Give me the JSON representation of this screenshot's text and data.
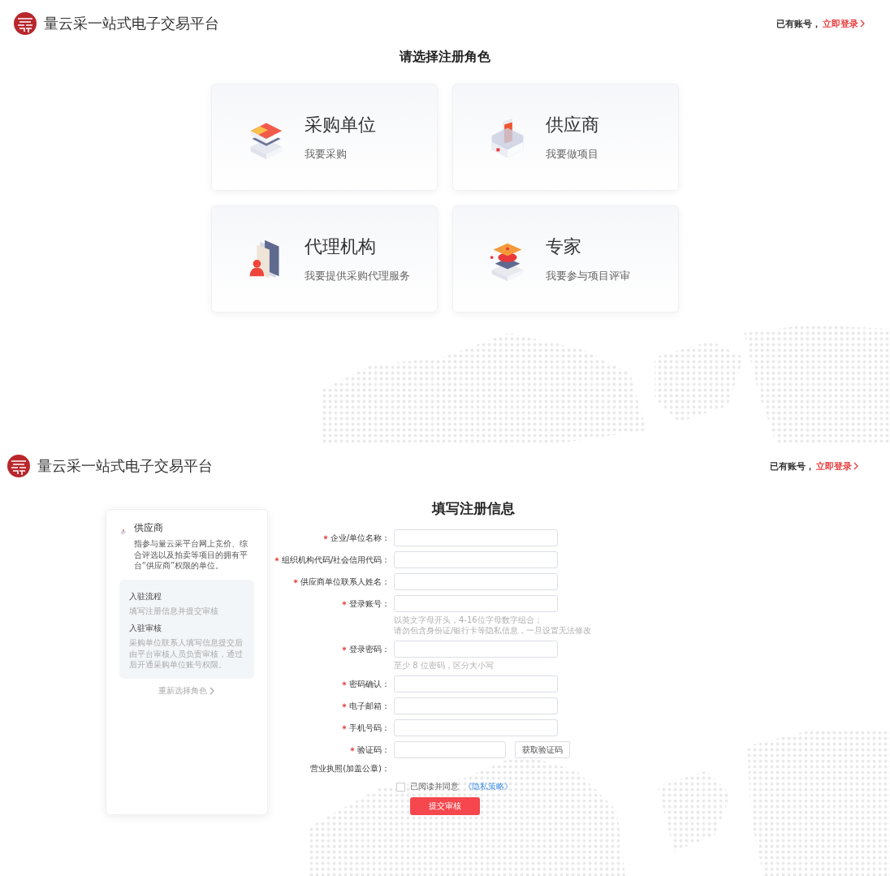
{
  "role_screen": {
    "header": {
      "site_title": "量云采一站式电子交易平台",
      "login_prompt": "已有账号，",
      "login_link": "立即登录"
    },
    "title": "请选择注册角色",
    "roles": [
      {
        "kind": "buyer",
        "name": "采购单位",
        "desc": "我要采购"
      },
      {
        "kind": "supplier",
        "name": "供应商",
        "desc": "我要做项目"
      },
      {
        "kind": "agency",
        "name": "代理机构",
        "desc": "我要提供采购代理服务"
      },
      {
        "kind": "expert",
        "name": "专家",
        "desc": "我要参与项目评审"
      }
    ]
  },
  "form_screen": {
    "header": {
      "site_title": "量云采一站式电子交易平台",
      "login_prompt": "已有账号，",
      "login_link": "立即登录"
    },
    "role_card": {
      "kind": "supplier",
      "name": "供应商",
      "desc": "指参与量云采平台网上竞价、综合评选以及拍卖等项目的拥有平台“供应商”权限的单位。",
      "steps": [
        {
          "title": "入驻流程",
          "text": "填写注册信息并提交审核"
        },
        {
          "title": "入驻审核",
          "text": "采购单位联系人填写信息提交后由平台审核人员负责审核，通过后开通采购单位账号权限。"
        }
      ],
      "reselect_link": "重新选择角色"
    },
    "title": "填写注册信息",
    "fields": [
      {
        "kind": "text",
        "label": "企业/单位名称：",
        "required": true
      },
      {
        "kind": "text",
        "label": "组织机构代码/社会信用代码：",
        "required": true
      },
      {
        "kind": "text",
        "label": "供应商单位联系人姓名：",
        "required": true
      },
      {
        "kind": "text",
        "label": "登录账号：",
        "required": true,
        "hints": [
          "以英文字母开头，4-16位字母数字组合；",
          "请勿包含身份证/银行卡等隐私信息，一旦设置无法修改"
        ]
      },
      {
        "kind": "text",
        "label": "登录密码：",
        "required": true,
        "hints": [
          "至少 8 位密码，区分大小写"
        ]
      },
      {
        "kind": "text",
        "label": "密码确认：",
        "required": true
      },
      {
        "kind": "text",
        "label": "电子邮箱：",
        "required": true
      },
      {
        "kind": "text",
        "label": "手机号码：",
        "required": true
      },
      {
        "kind": "captcha",
        "label": "验证码：",
        "required": true,
        "button": "获取验证码"
      },
      {
        "kind": "upload",
        "label": "营业执照(加盖公章)：",
        "required": false
      }
    ],
    "agreement": {
      "checked": false,
      "text": "已阅读并同意",
      "link": "《隐私策略》"
    },
    "submit": "提交审核"
  }
}
